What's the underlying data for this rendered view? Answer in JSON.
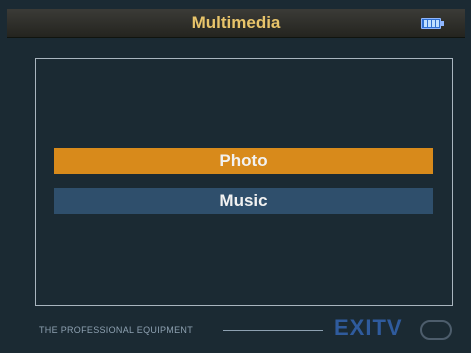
{
  "header": {
    "title": "Multimedia",
    "battery_icon": "battery-icon"
  },
  "menu": {
    "items": [
      {
        "label": "Photo",
        "selected": true
      },
      {
        "label": "Music",
        "selected": false
      }
    ]
  },
  "footer": {
    "text": "THE PROFESSIONAL EQUIPMENT",
    "brand": "EXITV"
  },
  "colors": {
    "title": "#e8c46a",
    "selected_item": "#d88a1b",
    "unselected_item": "#2f4f6c",
    "background": "#1b2a33"
  }
}
